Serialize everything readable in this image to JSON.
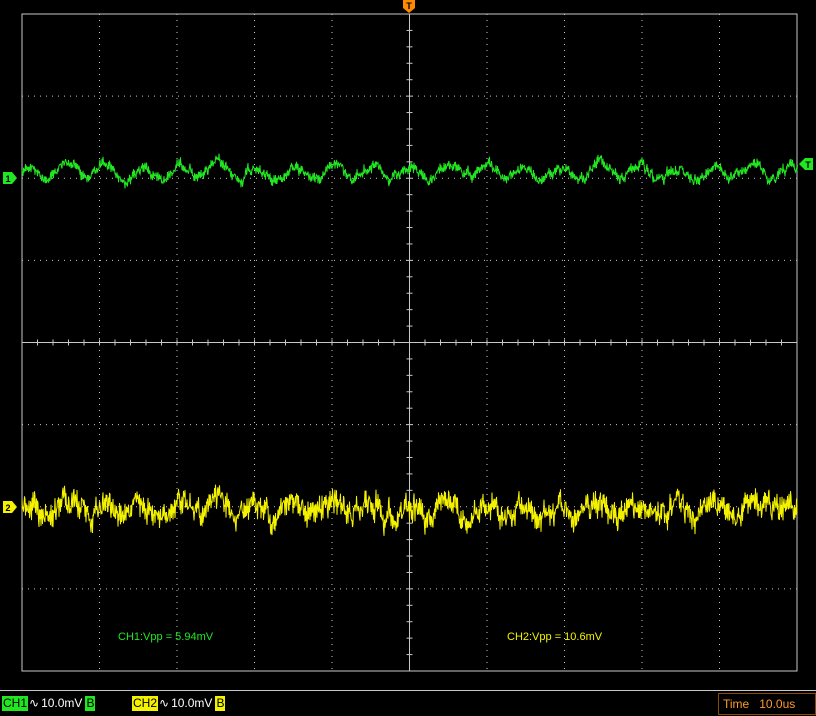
{
  "screen": {
    "trigger_marker": "T",
    "ch1_marker": "1",
    "ch2_marker": "2",
    "trigger_level_marker": "T"
  },
  "measurements": {
    "ch1": "CH1:Vpp = 5.94mV",
    "ch2": "CH2:Vpp = 10.6mV"
  },
  "status": {
    "ch1": {
      "label": "CH1",
      "coupling": "∿",
      "scale": "10.0mV",
      "bw": "B"
    },
    "ch2": {
      "label": "CH2",
      "coupling": "∿",
      "scale": "10.0mV",
      "bw": "B"
    },
    "time": {
      "label": "Time",
      "value": "10.0us"
    }
  },
  "colors": {
    "ch1": "#22e622",
    "ch2": "#f5f200",
    "grid": "#c8c8c8",
    "trigger": "#ff8a00",
    "time_text": "#ff9a2a"
  },
  "traces": {
    "ch1": {
      "label": "CH1",
      "vpp_mV": 5.94,
      "scale_mV_per_div": 10.0
    },
    "ch2": {
      "label": "CH2",
      "vpp_mV": 10.6,
      "scale_mV_per_div": 10.0
    }
  }
}
